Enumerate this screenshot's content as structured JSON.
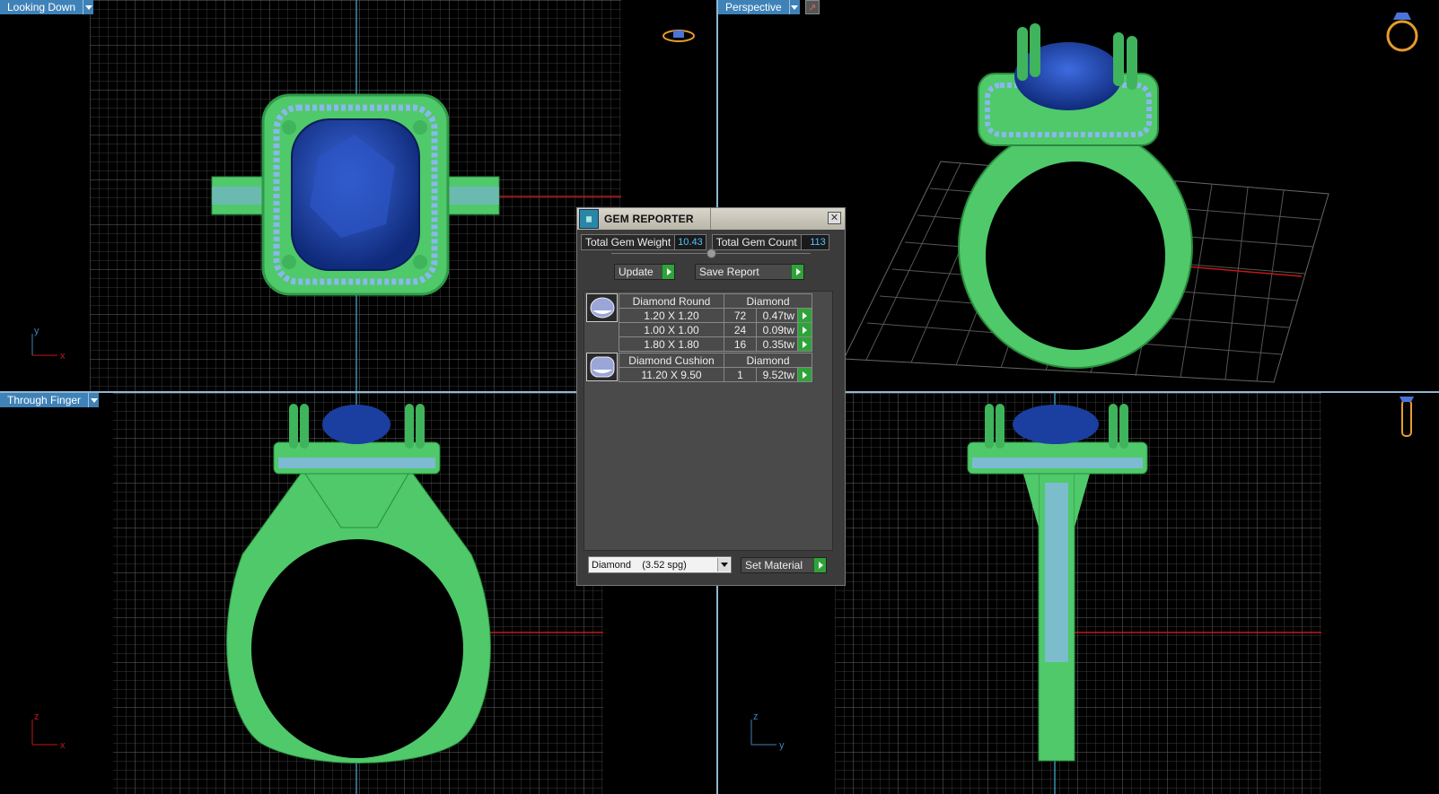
{
  "viewports": {
    "top_left": {
      "label": "Looking Down",
      "axis_v": "y",
      "axis_h": "x"
    },
    "top_right": {
      "label": "Perspective"
    },
    "bottom_left": {
      "label": "Through Finger",
      "axis_v": "z",
      "axis_h": "x"
    },
    "bottom_right": {
      "label": "",
      "axis_v": "z",
      "axis_h": "y"
    }
  },
  "gem_reporter": {
    "title": "GEM REPORTER",
    "total_weight_label": "Total Gem Weight",
    "total_weight_value": "10.43",
    "total_count_label": "Total Gem Count",
    "total_count_value": "113",
    "update_label": "Update",
    "save_report_label": "Save Report",
    "groups": [
      {
        "shape": "Diamond Round",
        "material": "Diamond",
        "rows": [
          {
            "size": "1.20 X 1.20",
            "count": "72",
            "weight": "0.47tw"
          },
          {
            "size": "1.00 X 1.00",
            "count": "24",
            "weight": "0.09tw"
          },
          {
            "size": "1.80 X 1.80",
            "count": "16",
            "weight": "0.35tw"
          }
        ]
      },
      {
        "shape": "Diamond Cushion",
        "material": "Diamond",
        "rows": [
          {
            "size": "11.20 X 9.50",
            "count": "1",
            "weight": "9.52tw"
          }
        ]
      }
    ],
    "material_select": "Diamond    (3.52 spg)",
    "set_material_label": "Set Material"
  },
  "colors": {
    "ring_green": "#4fc96a",
    "gem_blue": "#1a3fa0",
    "accent_blue": "#3f82b8",
    "go_green": "#2fa33a"
  }
}
